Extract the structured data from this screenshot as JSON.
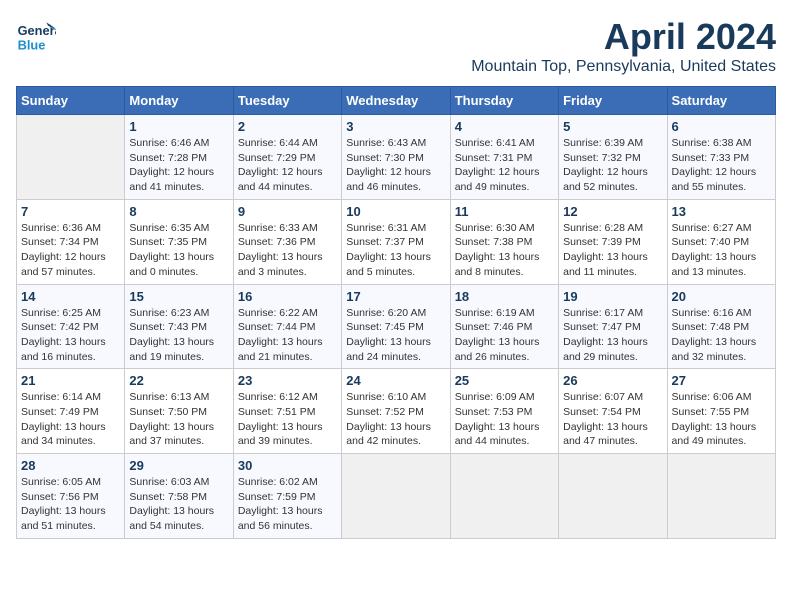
{
  "header": {
    "logo_general": "General",
    "logo_blue": "Blue",
    "month": "April 2024",
    "location": "Mountain Top, Pennsylvania, United States"
  },
  "days_of_week": [
    "Sunday",
    "Monday",
    "Tuesday",
    "Wednesday",
    "Thursday",
    "Friday",
    "Saturday"
  ],
  "weeks": [
    [
      {
        "day": "",
        "sunrise": "",
        "sunset": "",
        "daylight": ""
      },
      {
        "day": "1",
        "sunrise": "Sunrise: 6:46 AM",
        "sunset": "Sunset: 7:28 PM",
        "daylight": "Daylight: 12 hours and 41 minutes."
      },
      {
        "day": "2",
        "sunrise": "Sunrise: 6:44 AM",
        "sunset": "Sunset: 7:29 PM",
        "daylight": "Daylight: 12 hours and 44 minutes."
      },
      {
        "day": "3",
        "sunrise": "Sunrise: 6:43 AM",
        "sunset": "Sunset: 7:30 PM",
        "daylight": "Daylight: 12 hours and 46 minutes."
      },
      {
        "day": "4",
        "sunrise": "Sunrise: 6:41 AM",
        "sunset": "Sunset: 7:31 PM",
        "daylight": "Daylight: 12 hours and 49 minutes."
      },
      {
        "day": "5",
        "sunrise": "Sunrise: 6:39 AM",
        "sunset": "Sunset: 7:32 PM",
        "daylight": "Daylight: 12 hours and 52 minutes."
      },
      {
        "day": "6",
        "sunrise": "Sunrise: 6:38 AM",
        "sunset": "Sunset: 7:33 PM",
        "daylight": "Daylight: 12 hours and 55 minutes."
      }
    ],
    [
      {
        "day": "7",
        "sunrise": "Sunrise: 6:36 AM",
        "sunset": "Sunset: 7:34 PM",
        "daylight": "Daylight: 12 hours and 57 minutes."
      },
      {
        "day": "8",
        "sunrise": "Sunrise: 6:35 AM",
        "sunset": "Sunset: 7:35 PM",
        "daylight": "Daylight: 13 hours and 0 minutes."
      },
      {
        "day": "9",
        "sunrise": "Sunrise: 6:33 AM",
        "sunset": "Sunset: 7:36 PM",
        "daylight": "Daylight: 13 hours and 3 minutes."
      },
      {
        "day": "10",
        "sunrise": "Sunrise: 6:31 AM",
        "sunset": "Sunset: 7:37 PM",
        "daylight": "Daylight: 13 hours and 5 minutes."
      },
      {
        "day": "11",
        "sunrise": "Sunrise: 6:30 AM",
        "sunset": "Sunset: 7:38 PM",
        "daylight": "Daylight: 13 hours and 8 minutes."
      },
      {
        "day": "12",
        "sunrise": "Sunrise: 6:28 AM",
        "sunset": "Sunset: 7:39 PM",
        "daylight": "Daylight: 13 hours and 11 minutes."
      },
      {
        "day": "13",
        "sunrise": "Sunrise: 6:27 AM",
        "sunset": "Sunset: 7:40 PM",
        "daylight": "Daylight: 13 hours and 13 minutes."
      }
    ],
    [
      {
        "day": "14",
        "sunrise": "Sunrise: 6:25 AM",
        "sunset": "Sunset: 7:42 PM",
        "daylight": "Daylight: 13 hours and 16 minutes."
      },
      {
        "day": "15",
        "sunrise": "Sunrise: 6:23 AM",
        "sunset": "Sunset: 7:43 PM",
        "daylight": "Daylight: 13 hours and 19 minutes."
      },
      {
        "day": "16",
        "sunrise": "Sunrise: 6:22 AM",
        "sunset": "Sunset: 7:44 PM",
        "daylight": "Daylight: 13 hours and 21 minutes."
      },
      {
        "day": "17",
        "sunrise": "Sunrise: 6:20 AM",
        "sunset": "Sunset: 7:45 PM",
        "daylight": "Daylight: 13 hours and 24 minutes."
      },
      {
        "day": "18",
        "sunrise": "Sunrise: 6:19 AM",
        "sunset": "Sunset: 7:46 PM",
        "daylight": "Daylight: 13 hours and 26 minutes."
      },
      {
        "day": "19",
        "sunrise": "Sunrise: 6:17 AM",
        "sunset": "Sunset: 7:47 PM",
        "daylight": "Daylight: 13 hours and 29 minutes."
      },
      {
        "day": "20",
        "sunrise": "Sunrise: 6:16 AM",
        "sunset": "Sunset: 7:48 PM",
        "daylight": "Daylight: 13 hours and 32 minutes."
      }
    ],
    [
      {
        "day": "21",
        "sunrise": "Sunrise: 6:14 AM",
        "sunset": "Sunset: 7:49 PM",
        "daylight": "Daylight: 13 hours and 34 minutes."
      },
      {
        "day": "22",
        "sunrise": "Sunrise: 6:13 AM",
        "sunset": "Sunset: 7:50 PM",
        "daylight": "Daylight: 13 hours and 37 minutes."
      },
      {
        "day": "23",
        "sunrise": "Sunrise: 6:12 AM",
        "sunset": "Sunset: 7:51 PM",
        "daylight": "Daylight: 13 hours and 39 minutes."
      },
      {
        "day": "24",
        "sunrise": "Sunrise: 6:10 AM",
        "sunset": "Sunset: 7:52 PM",
        "daylight": "Daylight: 13 hours and 42 minutes."
      },
      {
        "day": "25",
        "sunrise": "Sunrise: 6:09 AM",
        "sunset": "Sunset: 7:53 PM",
        "daylight": "Daylight: 13 hours and 44 minutes."
      },
      {
        "day": "26",
        "sunrise": "Sunrise: 6:07 AM",
        "sunset": "Sunset: 7:54 PM",
        "daylight": "Daylight: 13 hours and 47 minutes."
      },
      {
        "day": "27",
        "sunrise": "Sunrise: 6:06 AM",
        "sunset": "Sunset: 7:55 PM",
        "daylight": "Daylight: 13 hours and 49 minutes."
      }
    ],
    [
      {
        "day": "28",
        "sunrise": "Sunrise: 6:05 AM",
        "sunset": "Sunset: 7:56 PM",
        "daylight": "Daylight: 13 hours and 51 minutes."
      },
      {
        "day": "29",
        "sunrise": "Sunrise: 6:03 AM",
        "sunset": "Sunset: 7:58 PM",
        "daylight": "Daylight: 13 hours and 54 minutes."
      },
      {
        "day": "30",
        "sunrise": "Sunrise: 6:02 AM",
        "sunset": "Sunset: 7:59 PM",
        "daylight": "Daylight: 13 hours and 56 minutes."
      },
      {
        "day": "",
        "sunrise": "",
        "sunset": "",
        "daylight": ""
      },
      {
        "day": "",
        "sunrise": "",
        "sunset": "",
        "daylight": ""
      },
      {
        "day": "",
        "sunrise": "",
        "sunset": "",
        "daylight": ""
      },
      {
        "day": "",
        "sunrise": "",
        "sunset": "",
        "daylight": ""
      }
    ]
  ]
}
